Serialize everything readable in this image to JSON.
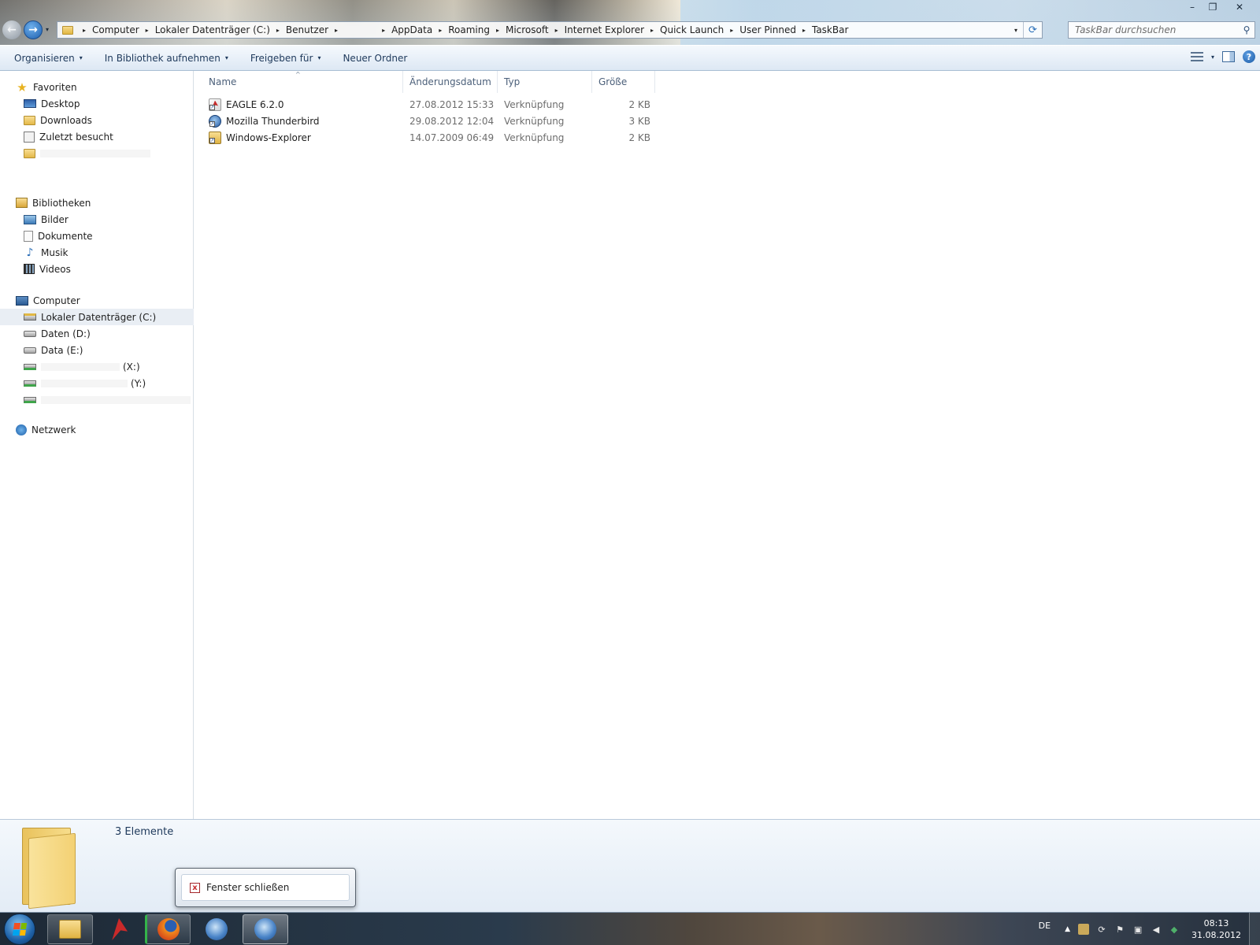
{
  "window": {
    "controls": {
      "minimize": "–",
      "maximize": "❐",
      "close": "✕"
    }
  },
  "nav": {
    "back": "←",
    "forward": "→",
    "dropdown": "▾"
  },
  "address": {
    "crumbs": [
      "Computer",
      "Lokaler Datenträger (C:)",
      "Benutzer",
      "",
      "AppData",
      "Roaming",
      "Microsoft",
      "Internet Explorer",
      "Quick Launch",
      "User Pinned",
      "TaskBar"
    ],
    "separator": "▸",
    "dropdown": "▾",
    "refresh": "⟳"
  },
  "search": {
    "placeholder": "TaskBar durchsuchen",
    "icon": "search-icon",
    "glyph": "⚲"
  },
  "toolbar": {
    "organize": "Organisieren",
    "library": "In Bibliothek aufnehmen",
    "share": "Freigeben für",
    "new_folder": "Neuer Ordner",
    "caret": "▾",
    "help": "?"
  },
  "navpane": {
    "favorites": {
      "label": "Favoriten",
      "items": [
        "Desktop",
        "Downloads",
        "Zuletzt besucht"
      ]
    },
    "libraries": {
      "label": "Bibliotheken",
      "items": [
        "Bilder",
        "Dokumente",
        "Musik",
        "Videos"
      ]
    },
    "computer": {
      "label": "Computer",
      "items": [
        "Lokaler Datenträger (C:)",
        "Daten (D:)",
        "Data (E:)",
        "(X:)",
        "(Y:)"
      ]
    },
    "network": {
      "label": "Netzwerk"
    }
  },
  "filelist": {
    "columns": [
      "Name",
      "Änderungsdatum",
      "Typ",
      "Größe"
    ],
    "sort_indicator": "^",
    "rows": [
      {
        "name": "EAGLE 6.2.0",
        "date": "27.08.2012 15:33",
        "type": "Verknüpfung",
        "size": "2 KB",
        "icon": "eagle-icon"
      },
      {
        "name": "Mozilla Thunderbird",
        "date": "29.08.2012 12:04",
        "type": "Verknüpfung",
        "size": "3 KB",
        "icon": "thunderbird-icon"
      },
      {
        "name": "Windows-Explorer",
        "date": "14.07.2009 06:49",
        "type": "Verknüpfung",
        "size": "2 KB",
        "icon": "windows-explorer-icon"
      }
    ]
  },
  "details": {
    "count": "3 Elemente"
  },
  "popup": {
    "close_label": "Fenster schließen",
    "close_glyph": "x"
  },
  "taskbar": {
    "tray": {
      "language": "DE",
      "show_hidden": "▲",
      "time": "08:13",
      "date": "31.08.2012"
    }
  }
}
